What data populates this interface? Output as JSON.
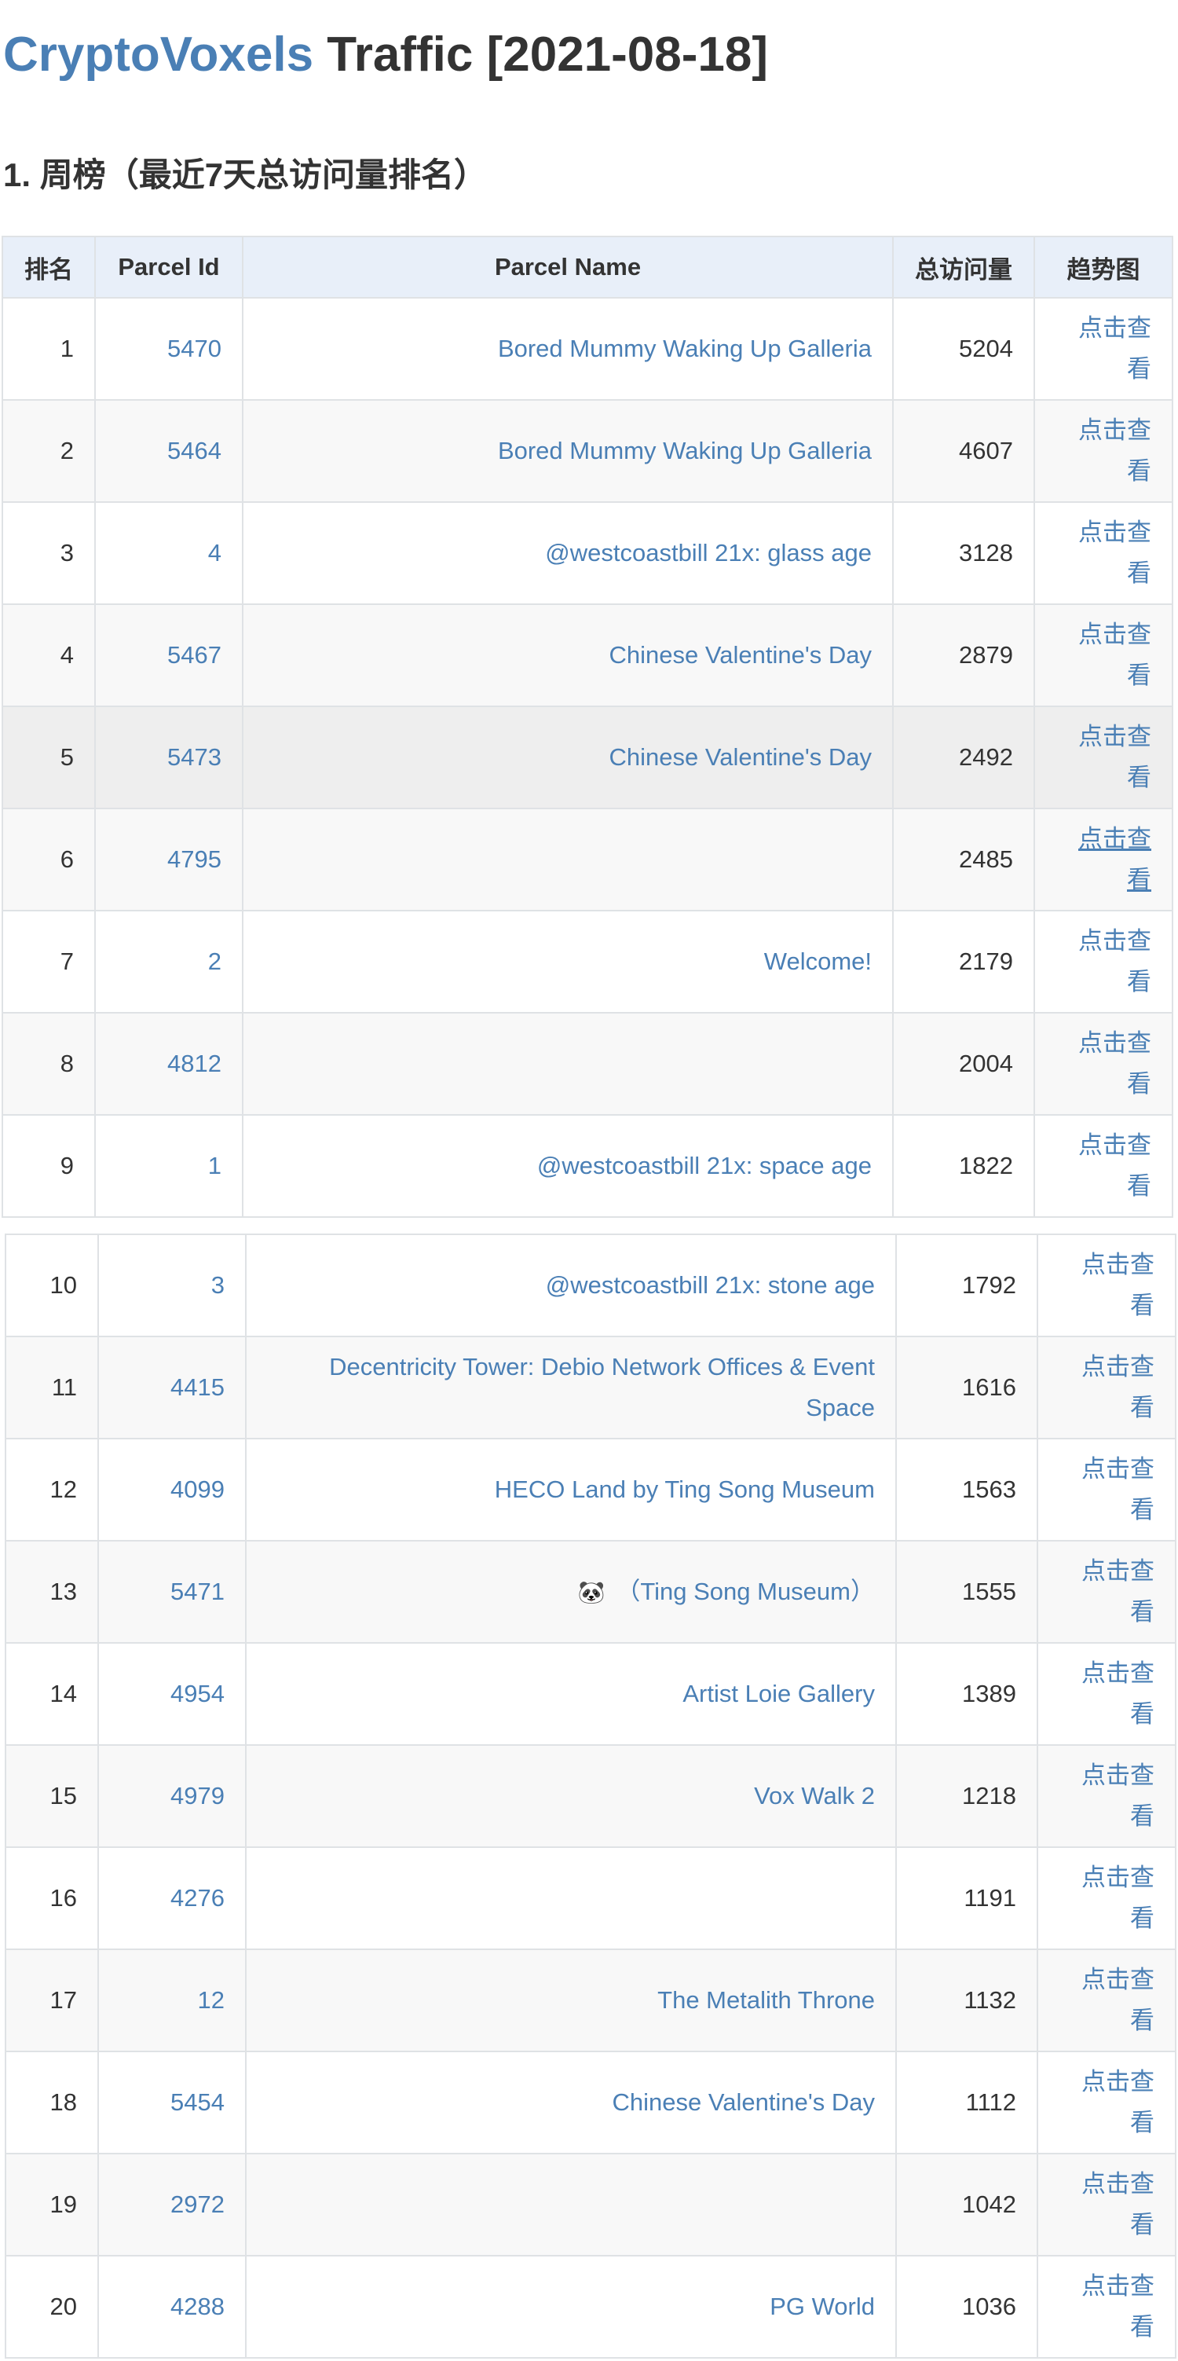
{
  "title": {
    "brand": "CryptoVoxels",
    "rest": " Traffic [2021-08-18]"
  },
  "section_heading": "1. 周榜（最近7天总访问量排名）",
  "table": {
    "headers": [
      "排名",
      "Parcel Id",
      "Parcel Name",
      "总访问量",
      "趋势图"
    ],
    "trend_link_label_line1": "点击查",
    "trend_link_label_line2": "看",
    "rows": [
      {
        "rank": "1",
        "parcel_id": "5470",
        "name": "Bored Mummy Waking Up Galleria",
        "visits": "5204"
      },
      {
        "rank": "2",
        "parcel_id": "5464",
        "name": "Bored Mummy Waking Up Galleria",
        "visits": "4607"
      },
      {
        "rank": "3",
        "parcel_id": "4",
        "name": "@westcoastbill 21x: glass age",
        "visits": "3128"
      },
      {
        "rank": "4",
        "parcel_id": "5467",
        "name": "Chinese Valentine's Day",
        "visits": "2879"
      },
      {
        "rank": "5",
        "parcel_id": "5473",
        "name": "Chinese Valentine's Day",
        "visits": "2492"
      },
      {
        "rank": "6",
        "parcel_id": "4795",
        "name": "",
        "visits": "2485"
      },
      {
        "rank": "7",
        "parcel_id": "2",
        "name": "Welcome!",
        "visits": "2179"
      },
      {
        "rank": "8",
        "parcel_id": "4812",
        "name": "",
        "visits": "2004"
      },
      {
        "rank": "9",
        "parcel_id": "1",
        "name": "@westcoastbill 21x: space age",
        "visits": "1822"
      },
      {
        "rank": "10",
        "parcel_id": "3",
        "name": "@westcoastbill 21x: stone age",
        "visits": "1792"
      },
      {
        "rank": "11",
        "parcel_id": "4415",
        "name": "Decentricity Tower: Debio Network Offices & Event Space",
        "visits": "1616"
      },
      {
        "rank": "12",
        "parcel_id": "4099",
        "name": "HECO Land by Ting Song Museum",
        "visits": "1563"
      },
      {
        "rank": "13",
        "parcel_id": "5471",
        "name": "（Ting Song Museum）",
        "visits": "1555",
        "icon": "panda-icon"
      },
      {
        "rank": "14",
        "parcel_id": "4954",
        "name": "Artist Loie Gallery",
        "visits": "1389"
      },
      {
        "rank": "15",
        "parcel_id": "4979",
        "name": "Vox Walk 2",
        "visits": "1218"
      },
      {
        "rank": "16",
        "parcel_id": "4276",
        "name": "",
        "visits": "1191"
      },
      {
        "rank": "17",
        "parcel_id": "12",
        "name": "The Metalith Throne",
        "visits": "1132"
      },
      {
        "rank": "18",
        "parcel_id": "5454",
        "name": "Chinese Valentine's Day",
        "visits": "1112"
      },
      {
        "rank": "19",
        "parcel_id": "2972",
        "name": "",
        "visits": "1042"
      },
      {
        "rank": "20",
        "parcel_id": "4288",
        "name": "PG World",
        "visits": "1036"
      }
    ]
  },
  "colors": {
    "link": "#4a7fb5",
    "header_bg": "#e8eff9",
    "text": "#333333"
  }
}
